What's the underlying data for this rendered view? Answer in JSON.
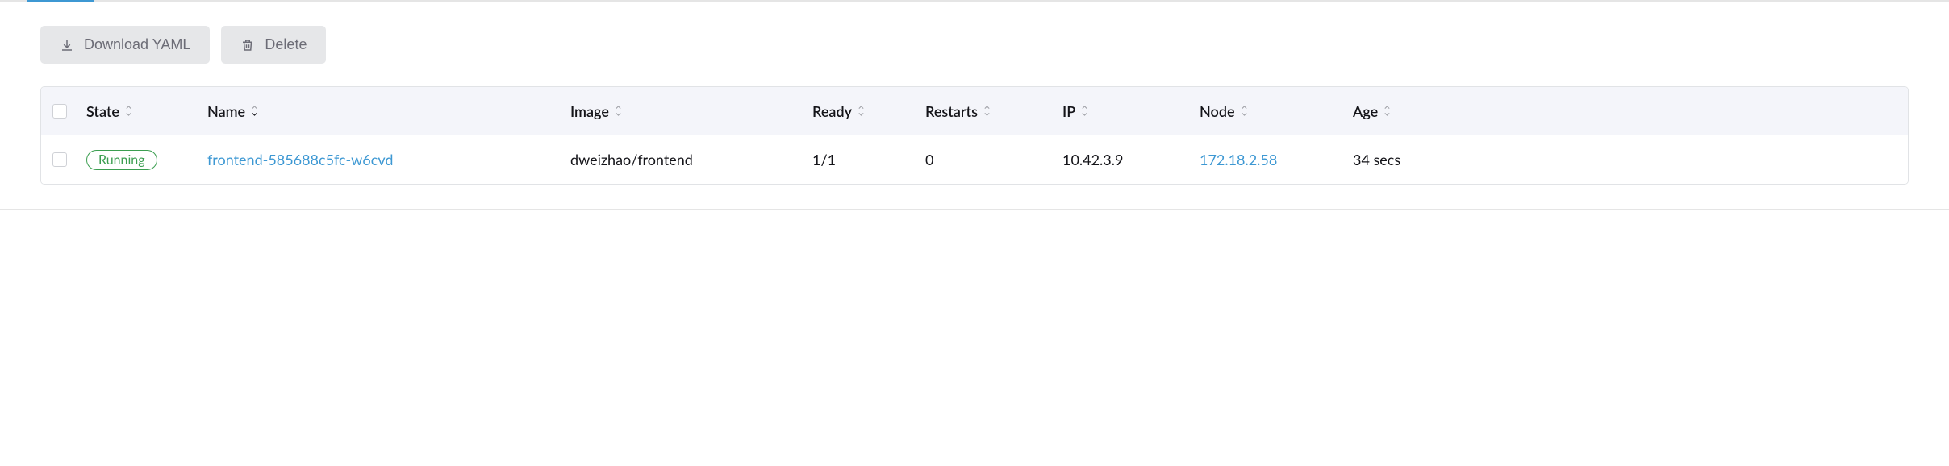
{
  "toolbar": {
    "download_label": "Download YAML",
    "delete_label": "Delete"
  },
  "columns": {
    "state": "State",
    "name": "Name",
    "image": "Image",
    "ready": "Ready",
    "restarts": "Restarts",
    "ip": "IP",
    "node": "Node",
    "age": "Age"
  },
  "rows": [
    {
      "state": "Running",
      "name": "frontend-585688c5fc-w6cvd",
      "image": "dweizhao/frontend",
      "ready": "1/1",
      "restarts": "0",
      "ip": "10.42.3.9",
      "node": "172.18.2.58",
      "age": "34 secs"
    }
  ]
}
